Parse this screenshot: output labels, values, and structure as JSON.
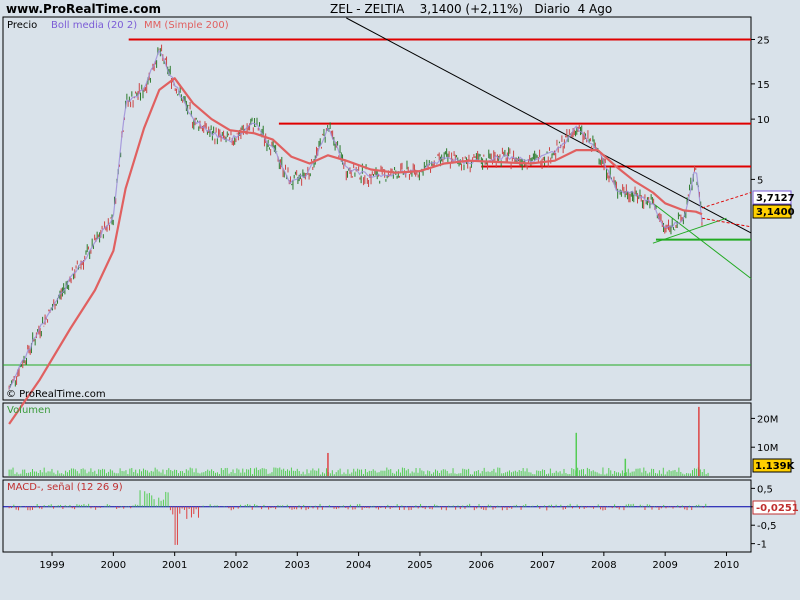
{
  "header": {
    "site": "www.ProRealTime.com",
    "title": "ZEL - ZELTIA    3,1400 (+2,11%)   Diario  4 Ago"
  },
  "price_panel": {
    "label_precio": "Precio",
    "label_boll": "Boll media (20 2)",
    "label_mm": "MM (Simple 200)",
    "watermark": "© ProRealTime.com",
    "badge_boll": "3,7127",
    "badge_price": "3,1400"
  },
  "volume_panel": {
    "label": "Volumen",
    "badge": "1.139K"
  },
  "macd_panel": {
    "label": "MACD-, señal (12 26 9)",
    "badge": "-0,0251"
  },
  "colors": {
    "background": "#d9e2ea",
    "price": "#2a7a2a",
    "mm200": "#e06060",
    "boll": "#9a8ad8",
    "resistance": "#e00000",
    "support": "#22aa22",
    "volume": "#55cc55",
    "macd_pos": "#55cc55",
    "macd_neg": "#dd4444"
  },
  "chart_data": [
    {
      "type": "line",
      "panel": "price",
      "yscale": "log",
      "x": [
        1998.3,
        1998.8,
        1999.3,
        1999.7,
        2000.0,
        2000.2,
        2000.5,
        2000.75,
        2001.0,
        2001.3,
        2001.6,
        2001.9,
        2002.3,
        2002.6,
        2002.9,
        2003.2,
        2003.5,
        2003.8,
        2004.2,
        2004.6,
        2005.0,
        2005.4,
        2005.8,
        2006.3,
        2006.8,
        2007.2,
        2007.55,
        2007.9,
        2008.2,
        2008.5,
        2008.8,
        2009.0,
        2009.3,
        2009.5,
        2009.6
      ],
      "series": [
        {
          "name": "Precio",
          "values": [
            0.45,
            0.9,
            1.6,
            2.4,
            3.3,
            12,
            14,
            22,
            15,
            10,
            8.5,
            7.8,
            9.5,
            7.2,
            4.8,
            5.5,
            9.2,
            5.6,
            5.2,
            5.4,
            5.5,
            6.4,
            6.1,
            6.5,
            6.2,
            6.8,
            9.0,
            7.0,
            4.5,
            4.2,
            3.8,
            2.8,
            3.2,
            5.8,
            3.14
          ]
        },
        {
          "name": "MM (Simple 200)",
          "values": [
            0.3,
            0.5,
            0.9,
            1.4,
            2.2,
            4.5,
            9,
            14,
            16,
            12,
            10,
            8.8,
            8.5,
            7.9,
            6.5,
            6.0,
            6.6,
            6.2,
            5.6,
            5.4,
            5.5,
            6.0,
            6.2,
            6.1,
            6.0,
            6.2,
            7.0,
            7.0,
            5.8,
            4.9,
            4.3,
            3.8,
            3.5,
            3.45,
            3.35
          ]
        }
      ],
      "horizontal_lines": [
        {
          "value": 25,
          "color": "#e00000"
        },
        {
          "value": 9.5,
          "color": "#e00000"
        },
        {
          "value": 5.8,
          "color": "#e00000"
        },
        {
          "value": 2.5,
          "color": "#22aa22"
        }
      ],
      "yticks": [
        25,
        15,
        10,
        5
      ],
      "xticks": [
        "1999",
        "2000",
        "2001",
        "2002",
        "2003",
        "2004",
        "2005",
        "2006",
        "2007",
        "2008",
        "2009",
        "2010"
      ],
      "xlim": [
        1998.2,
        2010.4
      ],
      "ylim": [
        0.4,
        32
      ],
      "current_values": [
        "3,7127",
        "3,1400"
      ]
    },
    {
      "type": "bar",
      "panel": "volume",
      "yticks": [
        "20M",
        "10M"
      ],
      "ylim": [
        0,
        25
      ],
      "spikes": [
        {
          "x": 2003.5,
          "value": 8
        },
        {
          "x": 2007.55,
          "value": 15
        },
        {
          "x": 2008.35,
          "value": 6
        },
        {
          "x": 2009.55,
          "value": 24
        }
      ]
    },
    {
      "type": "bar",
      "panel": "macd",
      "yticks": [
        "0,5",
        "0",
        "-0,5",
        "-1"
      ],
      "ylim": [
        -1.2,
        0.7
      ]
    }
  ]
}
